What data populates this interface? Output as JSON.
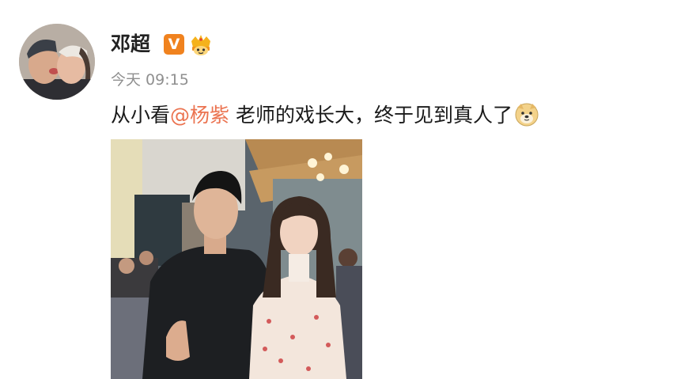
{
  "post": {
    "username": "邓超",
    "verified_badge_icon": "verified-v-icon",
    "verified_badge_text": "V",
    "member_badge_icon": "crown-member-icon",
    "timestamp": "今天 09:15",
    "content": {
      "prefix": "从小看",
      "mention": "@杨紫",
      "suffix": " 老师的戏长大，终于见到真人了",
      "emoji": "doge-emoji-icon"
    },
    "image_icon": "photo-two-people"
  },
  "colors": {
    "mention": "#eb7350",
    "verified": "#f0821e",
    "timestamp": "#8f8f8f",
    "text": "#1a1a1a"
  }
}
